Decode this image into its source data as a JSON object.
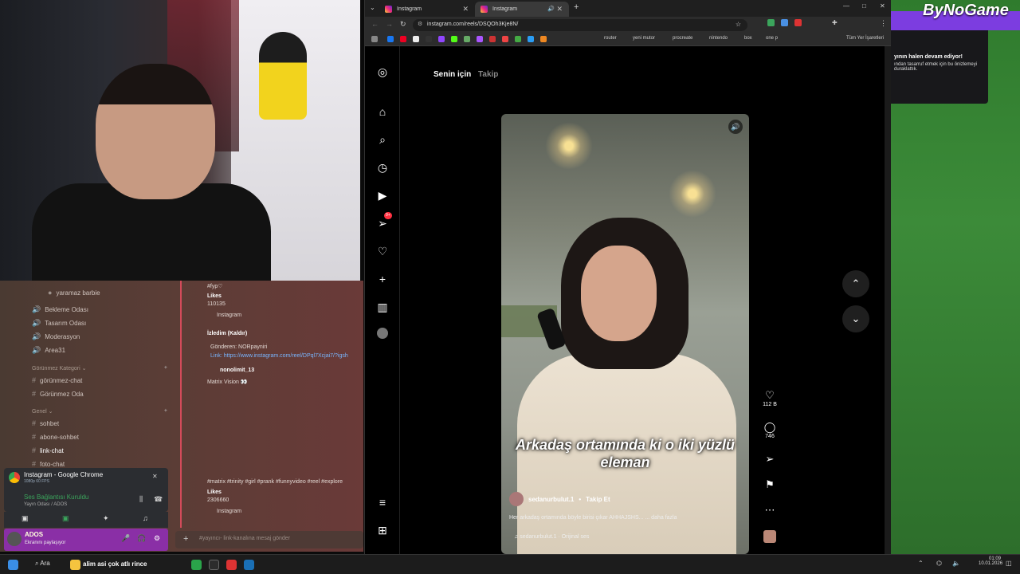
{
  "discord": {
    "channels": [
      {
        "label": "yaramaz barbie",
        "icon": "user-icon"
      },
      {
        "label": "Bekleme Odası",
        "icon": "speaker-icon"
      },
      {
        "label": "Tasarım Odası",
        "icon": "speaker-icon"
      },
      {
        "label": "Moderasyon",
        "icon": "speaker-icon"
      },
      {
        "label": "Area31",
        "icon": "speaker-icon"
      }
    ],
    "category_hidden": "Görünmez Kategori",
    "hidden_channels": [
      "görünmez-chat",
      "Görünmez Oda"
    ],
    "category_general": "Genel",
    "general_channels": [
      "sohbet",
      "abone-sohbet",
      "link-chat",
      "foto-chat"
    ],
    "voice_app": "Instagram - Google Chrome",
    "voice_app_sub": "1080p 60 FPS",
    "voice_status": "Ses Bağlantısı Kuruldu",
    "voice_room": "Yayın Odası / ADOS",
    "username": "ADOS",
    "user_status": "Ekranını paylaşıyor",
    "chat_input_placeholder": "#yayıncı- link-kanalına mesaj gönder",
    "messages": [
      {
        "text": "#fyp♡"
      },
      {
        "text": "Likes",
        "bold": true
      },
      {
        "text": "110135"
      },
      {
        "text": "Instagram"
      },
      {
        "text": "İzledim (Kaldır)",
        "bold": true
      },
      {
        "text": "Gönderen: NORpayniri"
      },
      {
        "text": "Link: https://www.instagram.com/reel/DPql7Xcjai7/?igsh",
        "link": true
      },
      {
        "text": "nonolimit_13",
        "bold": true
      },
      {
        "text": "Matrix Vision 👀"
      },
      {
        "text": "#matrix #trinity #girl #prank #funnyvideo #reel #explore"
      },
      {
        "text": "Likes",
        "bold": true
      },
      {
        "text": "2306660"
      },
      {
        "text": "Instagram"
      }
    ]
  },
  "browser": {
    "tabs": [
      {
        "label": "Instagram"
      },
      {
        "label": "Instagram"
      }
    ],
    "url": "instagram.com/reels/DSQOh3Kje8N/",
    "bookmarks": [
      "router",
      "yeni mutor",
      "procreate",
      "nintendo",
      "box",
      "one p",
      "Tüm Yer İşaretleri"
    ]
  },
  "instagram": {
    "feed_tabs": {
      "for_you": "Senin için",
      "following": "Takip"
    },
    "notification_badge": "9+",
    "caption": "Arkadaş ortamında ki o iki yüzlü eleman",
    "author": "sedanurbulut.1",
    "follow": "Takip Et",
    "description": "Her arkadaş ortamında böyle birisi çıkar AHHAJSHS... ... daha fazla",
    "audio": "sedanurbulut.1 · Orijinal ses",
    "likes": "112 B",
    "comments": "746"
  },
  "right_panel": {
    "brand": "ByNoGame",
    "preview_title": "yının halen devam ediyor!",
    "preview_text": "ından tasarruf etmek için bu önizlemeyi duraklattık."
  },
  "taskbar": {
    "search": "Ara",
    "time": "01:09",
    "date": "10.01.2026",
    "media": "alim asi çok atlı rince"
  },
  "colors": {
    "accent": "#ff3040",
    "discord_user": "#8a2fa6",
    "twitch_purple": "#7c3de0"
  }
}
